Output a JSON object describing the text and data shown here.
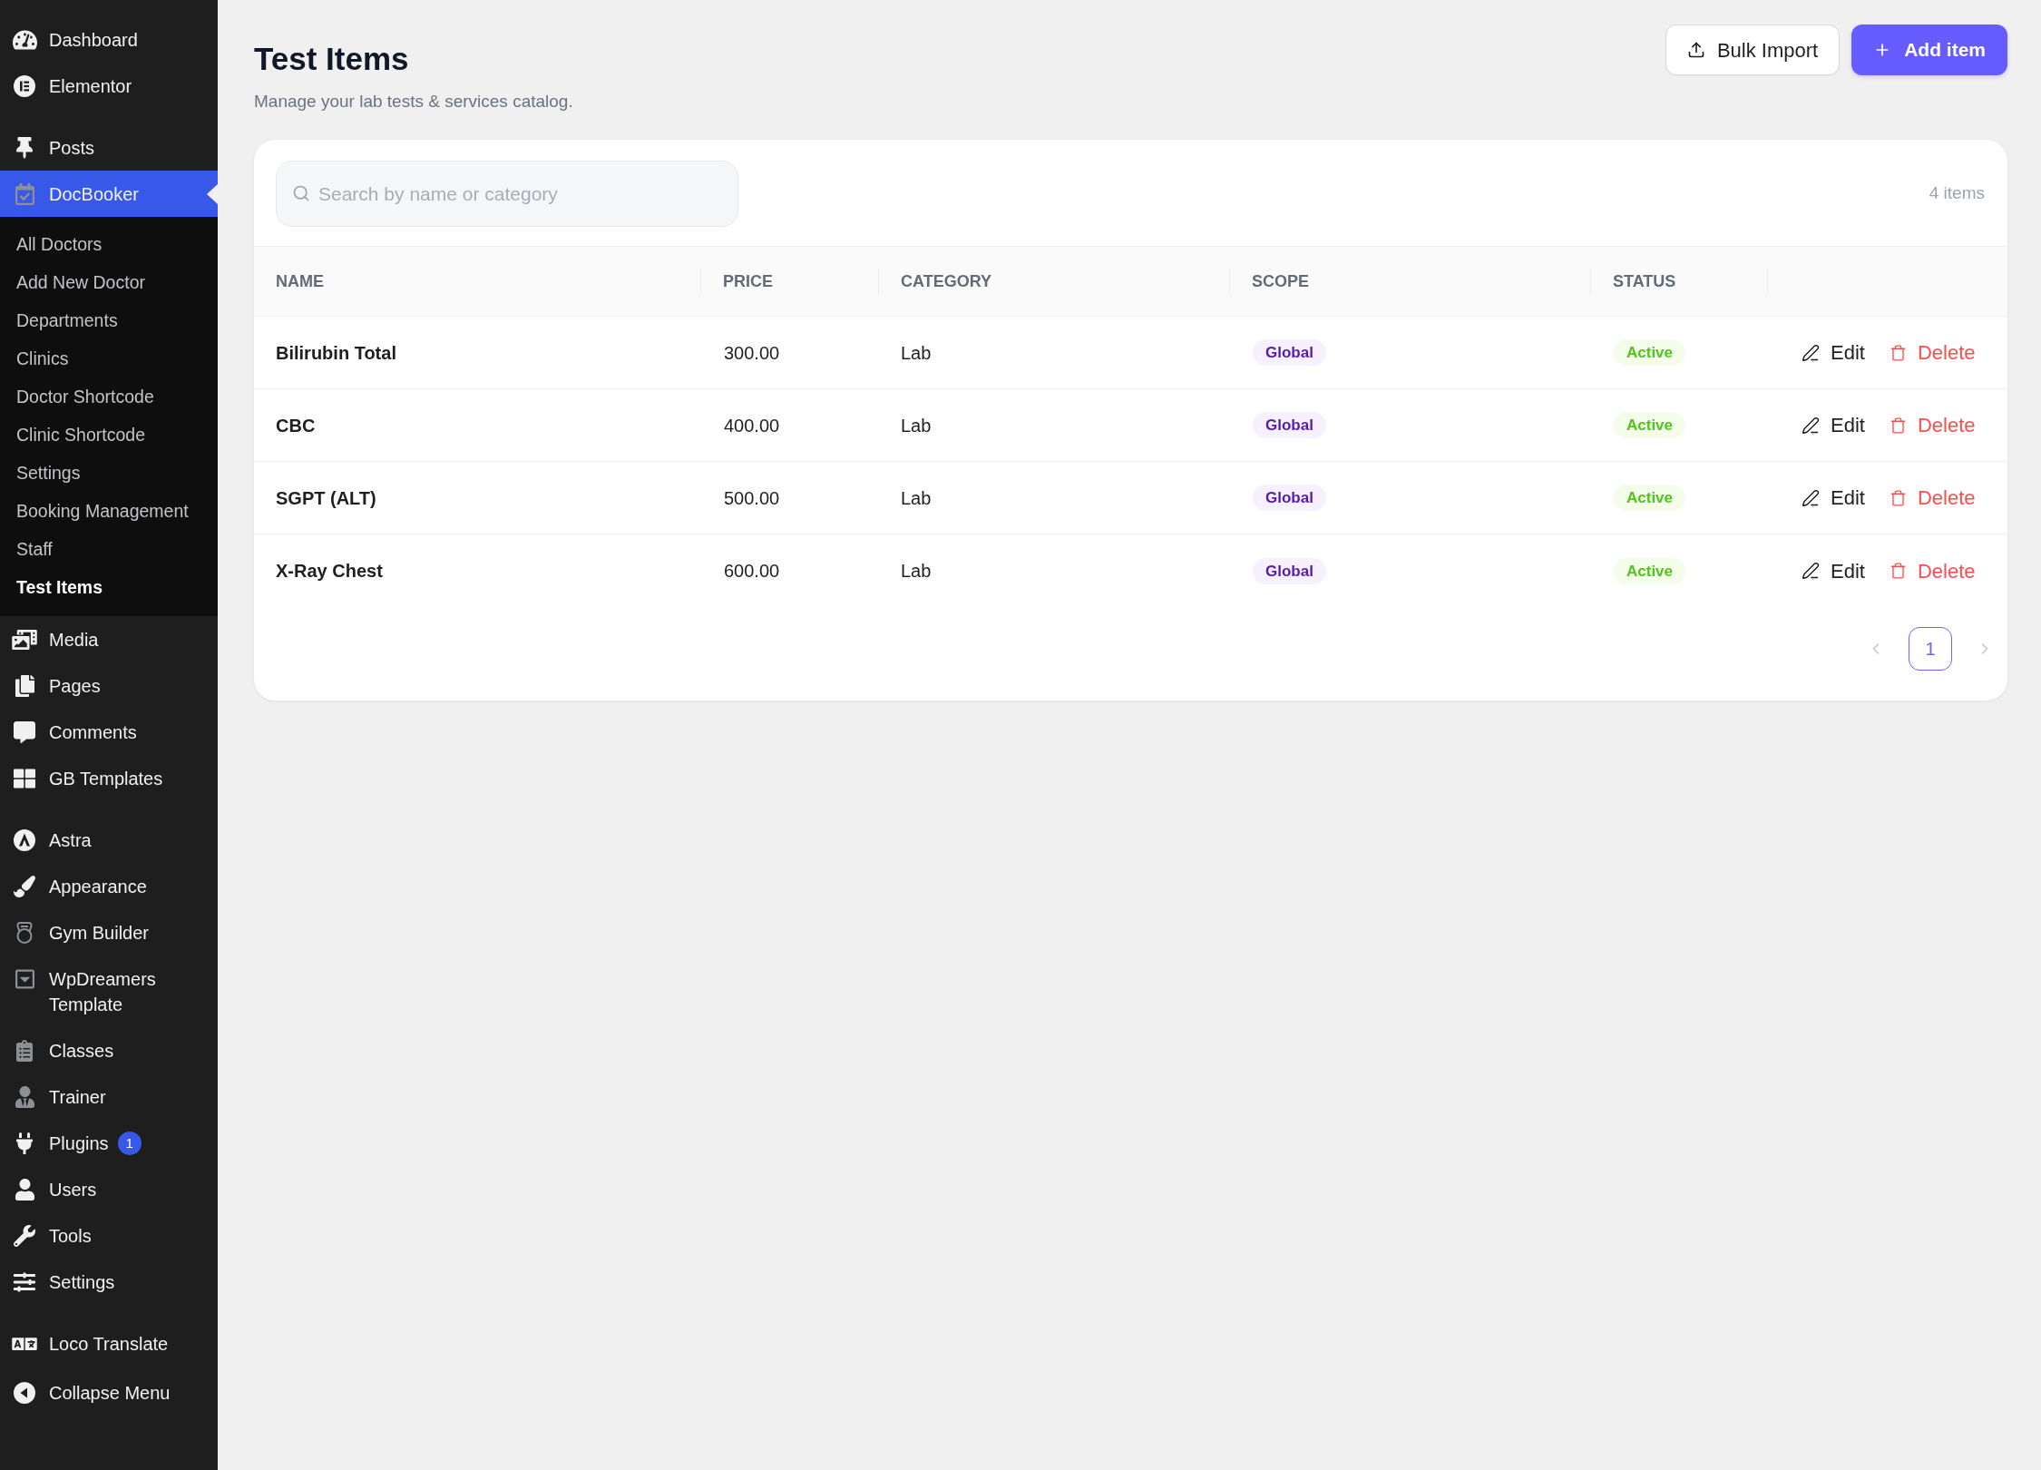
{
  "sidebar": {
    "groups": [
      {
        "items": [
          {
            "label": "Dashboard",
            "selected": false
          },
          {
            "label": "Elementor",
            "selected": false
          }
        ]
      },
      {
        "items": [
          {
            "label": "Posts",
            "selected": false
          },
          {
            "label": "DocBooker",
            "selected": true,
            "submenu": [
              {
                "label": "All Doctors",
                "selected": false
              },
              {
                "label": "Add New Doctor",
                "selected": false
              },
              {
                "label": "Departments",
                "selected": false
              },
              {
                "label": "Clinics",
                "selected": false
              },
              {
                "label": "Doctor Shortcode",
                "selected": false
              },
              {
                "label": "Clinic Shortcode",
                "selected": false
              },
              {
                "label": "Settings",
                "selected": false
              },
              {
                "label": "Booking Management",
                "selected": false
              },
              {
                "label": "Staff",
                "selected": false
              },
              {
                "label": "Test Items",
                "selected": true
              }
            ]
          },
          {
            "label": "Media",
            "selected": false
          },
          {
            "label": "Pages",
            "selected": false
          },
          {
            "label": "Comments",
            "selected": false
          },
          {
            "label": "GB Templates",
            "selected": false
          }
        ]
      },
      {
        "items": [
          {
            "label": "Astra",
            "selected": false
          },
          {
            "label": "Appearance",
            "selected": false
          },
          {
            "label": "Gym Builder",
            "selected": false
          },
          {
            "label": "WpDreamers Template",
            "selected": false
          },
          {
            "label": "Classes",
            "selected": false
          },
          {
            "label": "Trainer",
            "selected": false
          },
          {
            "label": "Plugins",
            "selected": false,
            "badge": "1"
          },
          {
            "label": "Users",
            "selected": false
          },
          {
            "label": "Tools",
            "selected": false
          },
          {
            "label": "Settings",
            "selected": false
          }
        ]
      },
      {
        "items": [
          {
            "label": "Loco Translate",
            "selected": false
          }
        ]
      }
    ],
    "collapse": {
      "label": "Collapse Menu"
    }
  },
  "header": {
    "title": "Test Items",
    "subtitle": "Manage your lab tests & services catalog.",
    "actions": [
      {
        "label": "Bulk Import",
        "kind": "import"
      },
      {
        "label": "Add item",
        "kind": "add"
      }
    ]
  },
  "catalog": {
    "search": {
      "placeholder": "Search by name or category"
    },
    "item_count": "4 items",
    "table": {
      "columns": [
        "NAME",
        "PRICE",
        "CATEGORY",
        "SCOPE",
        "STATUS"
      ],
      "rows": [
        {
          "name": "Bilirubin Total",
          "price": "300.00",
          "category": "Lab",
          "scope": "Global",
          "status": "Active",
          "actions": [
            {
              "label": "Edit",
              "kind": "edit"
            },
            {
              "label": "Delete",
              "kind": "delete"
            }
          ]
        },
        {
          "name": "CBC",
          "price": "400.00",
          "category": "Lab",
          "scope": "Global",
          "status": "Active",
          "actions": [
            {
              "label": "Edit",
              "kind": "edit"
            },
            {
              "label": "Delete",
              "kind": "delete"
            }
          ]
        },
        {
          "name": "SGPT (ALT)",
          "price": "500.00",
          "category": "Lab",
          "scope": "Global",
          "status": "Active",
          "actions": [
            {
              "label": "Edit",
              "kind": "edit"
            },
            {
              "label": "Delete",
              "kind": "delete"
            }
          ]
        },
        {
          "name": "X-Ray Chest",
          "price": "600.00",
          "category": "Lab",
          "scope": "Global",
          "status": "Active",
          "actions": [
            {
              "label": "Edit",
              "kind": "edit"
            },
            {
              "label": "Delete",
              "kind": "delete"
            }
          ]
        }
      ]
    },
    "pagination": {
      "previous": {
        "disabled": true
      },
      "pages": [
        {
          "label": "1",
          "selected": true
        }
      ],
      "next": {
        "disabled": true
      }
    }
  }
}
